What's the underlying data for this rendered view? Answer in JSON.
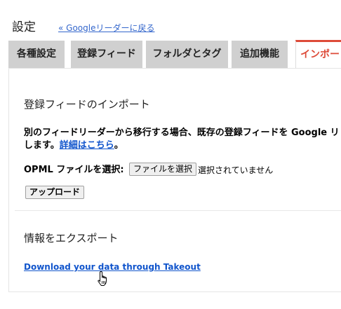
{
  "header": {
    "title": "設定",
    "back_link": "« Googleリーダーに戻る"
  },
  "tabs": [
    {
      "label": "各種設定",
      "active": false
    },
    {
      "label": "登録フィード",
      "active": false
    },
    {
      "label": "フォルダとタグ",
      "active": false
    },
    {
      "label": "追加機能",
      "active": false
    },
    {
      "label": "インポー",
      "active": true
    }
  ],
  "import_section": {
    "heading": "登録フィードのインポート",
    "desc_line1": "別のフィードリーダーから移行する場合、既存の登録フィードを Google リ",
    "desc_line2_prefix": "します。",
    "desc_link": "詳細はこちら",
    "desc_line2_suffix": "。",
    "opml_label": "OPML ファイルを選択:",
    "file_button": "ファイルを選択",
    "no_file_text": "選択されていません",
    "upload_button": "アップロード"
  },
  "export_section": {
    "heading": "情報をエクスポート",
    "takeout_link": "Download your data through Takeout"
  },
  "colors": {
    "active_tab": "#dd4b39",
    "link": "#1155cc",
    "tab_bg": "#d0d0d0"
  }
}
